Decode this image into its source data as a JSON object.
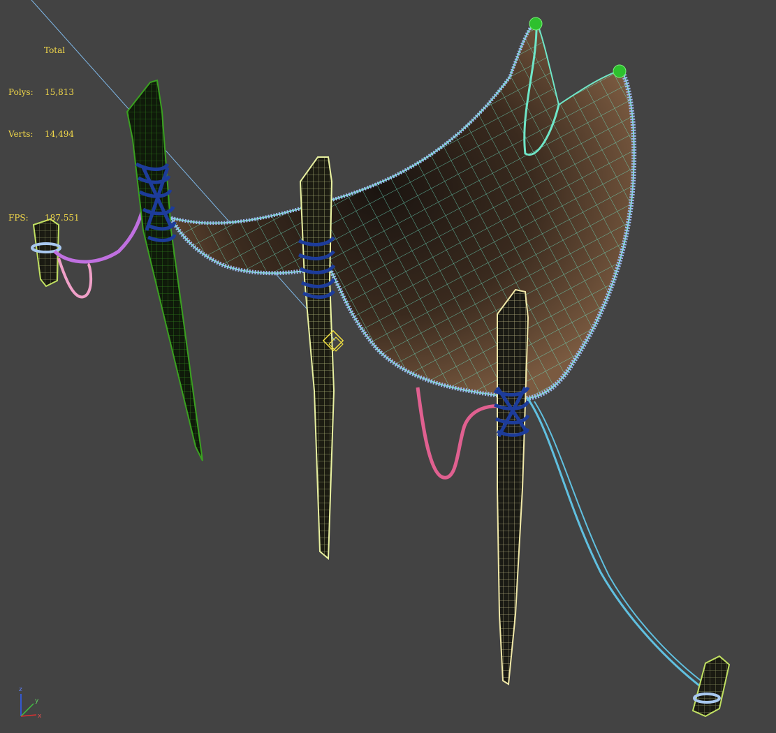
{
  "viewport": {
    "background": "#434343",
    "stats": {
      "total_label": "Total",
      "polys_label": "Polys:",
      "polys_value": "15,813",
      "verts_label": "Verts:",
      "verts_value": "14,494",
      "fps_label": "FPS:",
      "fps_value": "187.551",
      "color": "#f2d84a"
    },
    "axis_gizmo": {
      "x_label": "x",
      "y_label": "y",
      "z_label": "z",
      "x_color": "#e03030",
      "y_color": "#40c040",
      "z_color": "#3060ff"
    },
    "colors": {
      "net_wire": "#6fe6c8",
      "net_fringe": "#9cb8f0",
      "pole_green": "#3aa020",
      "pole_yellow": "#e8f0a0",
      "pole_cream": "#f0e8a8",
      "rope_blue": "#1d3c9a",
      "rope_purple": "#c070e0",
      "rope_pink": "#e06090",
      "rope_cyan": "#60c0e0",
      "selection_line": "#7fb8e8",
      "light_icon": "#f0e040"
    }
  }
}
